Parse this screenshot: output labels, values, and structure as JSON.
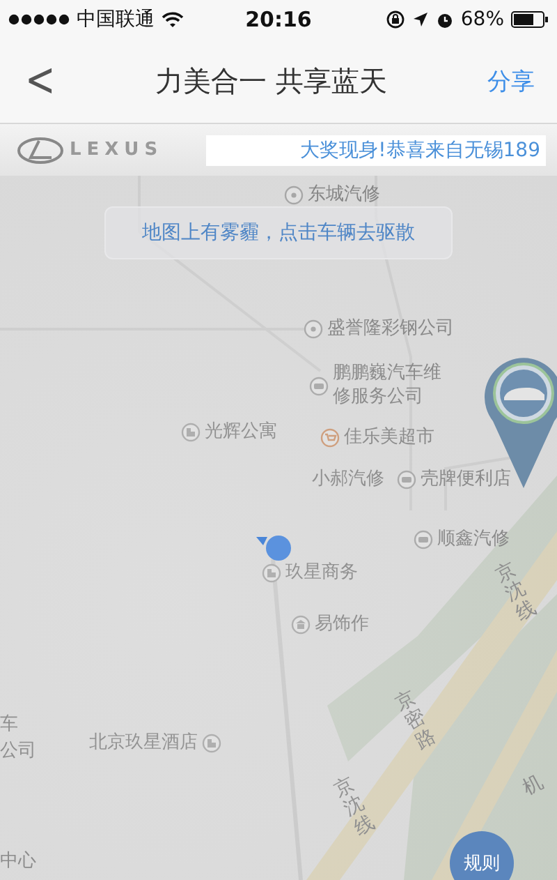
{
  "status_bar": {
    "carrier": "中国联通",
    "time": "20:16",
    "battery": "68%"
  },
  "nav": {
    "back": "<",
    "title": "力美合一 共享蓝天",
    "action": "分享"
  },
  "banner": {
    "logo": "LEXUS",
    "marquee": "大奖现身!恭喜来自无锡189"
  },
  "map": {
    "notice": "地图上有雾霾，点击车辆去驱散",
    "pois": [
      {
        "label": "东城汽修",
        "kind": "dot"
      },
      {
        "label": "盛誉隆彩钢公司",
        "kind": "dot"
      },
      {
        "label": "鹏鹏巍汽车维修服务公司",
        "kind": "car"
      },
      {
        "label": "光辉公寓",
        "kind": "building"
      },
      {
        "label": "佳乐美超市",
        "kind": "shop"
      },
      {
        "label": "小郝汽修",
        "kind": "none"
      },
      {
        "label": "壳牌便利店",
        "kind": "car"
      },
      {
        "label": "顺鑫汽修",
        "kind": "car"
      },
      {
        "label": "玖星商务",
        "kind": "building"
      },
      {
        "label": "易饰作",
        "kind": "bank"
      },
      {
        "label": "北京玖星酒店",
        "kind": "building"
      },
      {
        "label": "车",
        "kind": "none"
      },
      {
        "label": "公司",
        "kind": "none"
      },
      {
        "label": "中心",
        "kind": "none"
      }
    ],
    "roads": [
      {
        "label": "京沈线"
      },
      {
        "label": "京密路"
      },
      {
        "label": "京沈线"
      },
      {
        "label": "机"
      }
    ],
    "rules_button": "规则"
  }
}
